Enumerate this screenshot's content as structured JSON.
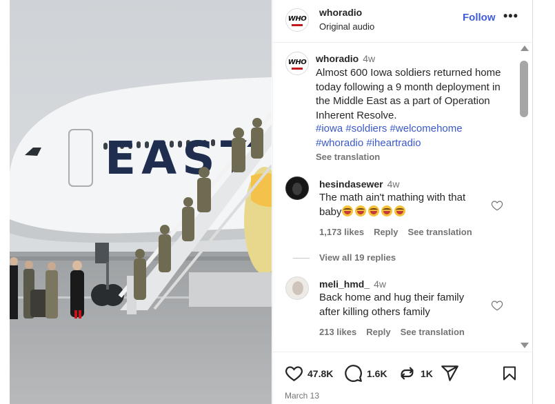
{
  "post": {
    "username": "whoradio",
    "audio": "Original audio",
    "follow_label": "Follow",
    "more_label": "•••",
    "avatar_logo": "WHO"
  },
  "caption": {
    "username": "whoradio",
    "time": "4w",
    "text": "Almost 600 Iowa soldiers returned home today following a 9 month deployment in the Middle East as a part of Operation Inherent Resolve.",
    "hashtags": "#iowa #soldiers #welcomehome #whoradio #iheartradio",
    "see_translation": "See translation"
  },
  "comments": [
    {
      "username": "hesindasewer",
      "time": "4w",
      "text": "The math ain't mathing with that baby",
      "emojis": 5,
      "likes": "1,173 likes",
      "reply": "Reply",
      "see_translation": "See translation",
      "view_replies": "View all 19 replies"
    },
    {
      "username": "meli_hmd_",
      "time": "4w",
      "text": "Back home and hug their family after killing others family",
      "likes": "213 likes",
      "reply": "Reply",
      "see_translation": "See translation"
    }
  ],
  "actions": {
    "like_count": "47.8K",
    "comment_count": "1.6K",
    "repost_count": "1K",
    "like_icon": "heart-icon",
    "comment_icon": "comment-icon",
    "repost_icon": "repost-icon",
    "share_icon": "share-icon",
    "save_icon": "bookmark-icon"
  },
  "date": "March 13",
  "media": {
    "plane_lettering": "EAST"
  },
  "colors": {
    "follow": "#3f5bd8",
    "hashtag": "#3a59c7",
    "muted": "#737373"
  }
}
